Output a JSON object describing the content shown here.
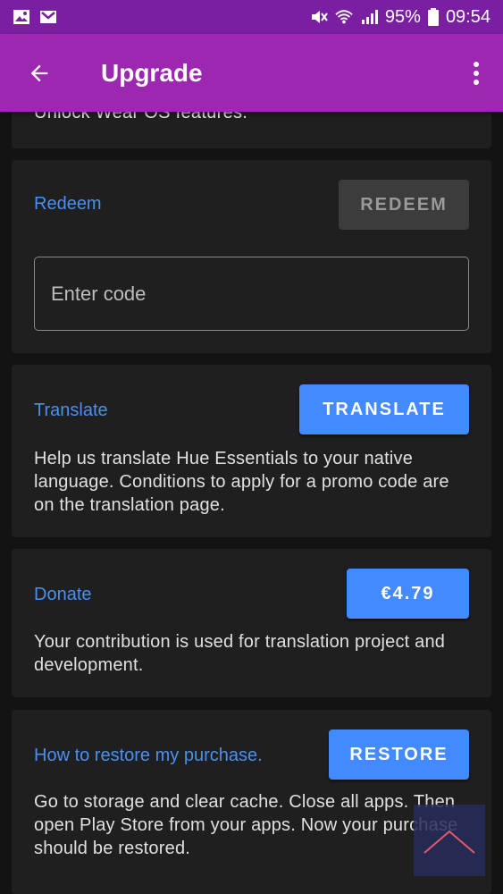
{
  "statusbar": {
    "left_icons": [
      "image-icon",
      "gmail-icon"
    ],
    "battery": "95%",
    "time": "09:54",
    "right_icons": [
      "mute-icon",
      "wifi-icon",
      "signal-icon",
      "battery-icon"
    ]
  },
  "appbar": {
    "title": "Upgrade",
    "back_icon": "arrow-left-icon",
    "more_icon": "more-vert-icon"
  },
  "cards": {
    "top": {
      "description": "Unlock Wear OS features."
    },
    "redeem": {
      "label": "Redeem",
      "button": "REDEEM",
      "input_placeholder": "Enter code",
      "input_value": ""
    },
    "translate": {
      "label": "Translate",
      "button": "TRANSLATE",
      "description": "Help us translate Hue Essentials to your native language. Conditions to apply for a promo code are on the translation page."
    },
    "donate": {
      "label": "Donate",
      "button": "€4.79",
      "description": "Your contribution is used for translation project and development."
    },
    "restore": {
      "label": "How to restore my purchase.",
      "button": "RESTORE",
      "description": "Go to storage and clear cache. Close all apps. Then open Play Store from your apps. Now your purchase should be restored."
    }
  },
  "colors": {
    "appbar": "#9c27b0",
    "statusbar": "#7b1fa2",
    "accent": "#448aff",
    "link": "#4a90f0",
    "card": "#1f1f1f",
    "background": "#131313"
  }
}
